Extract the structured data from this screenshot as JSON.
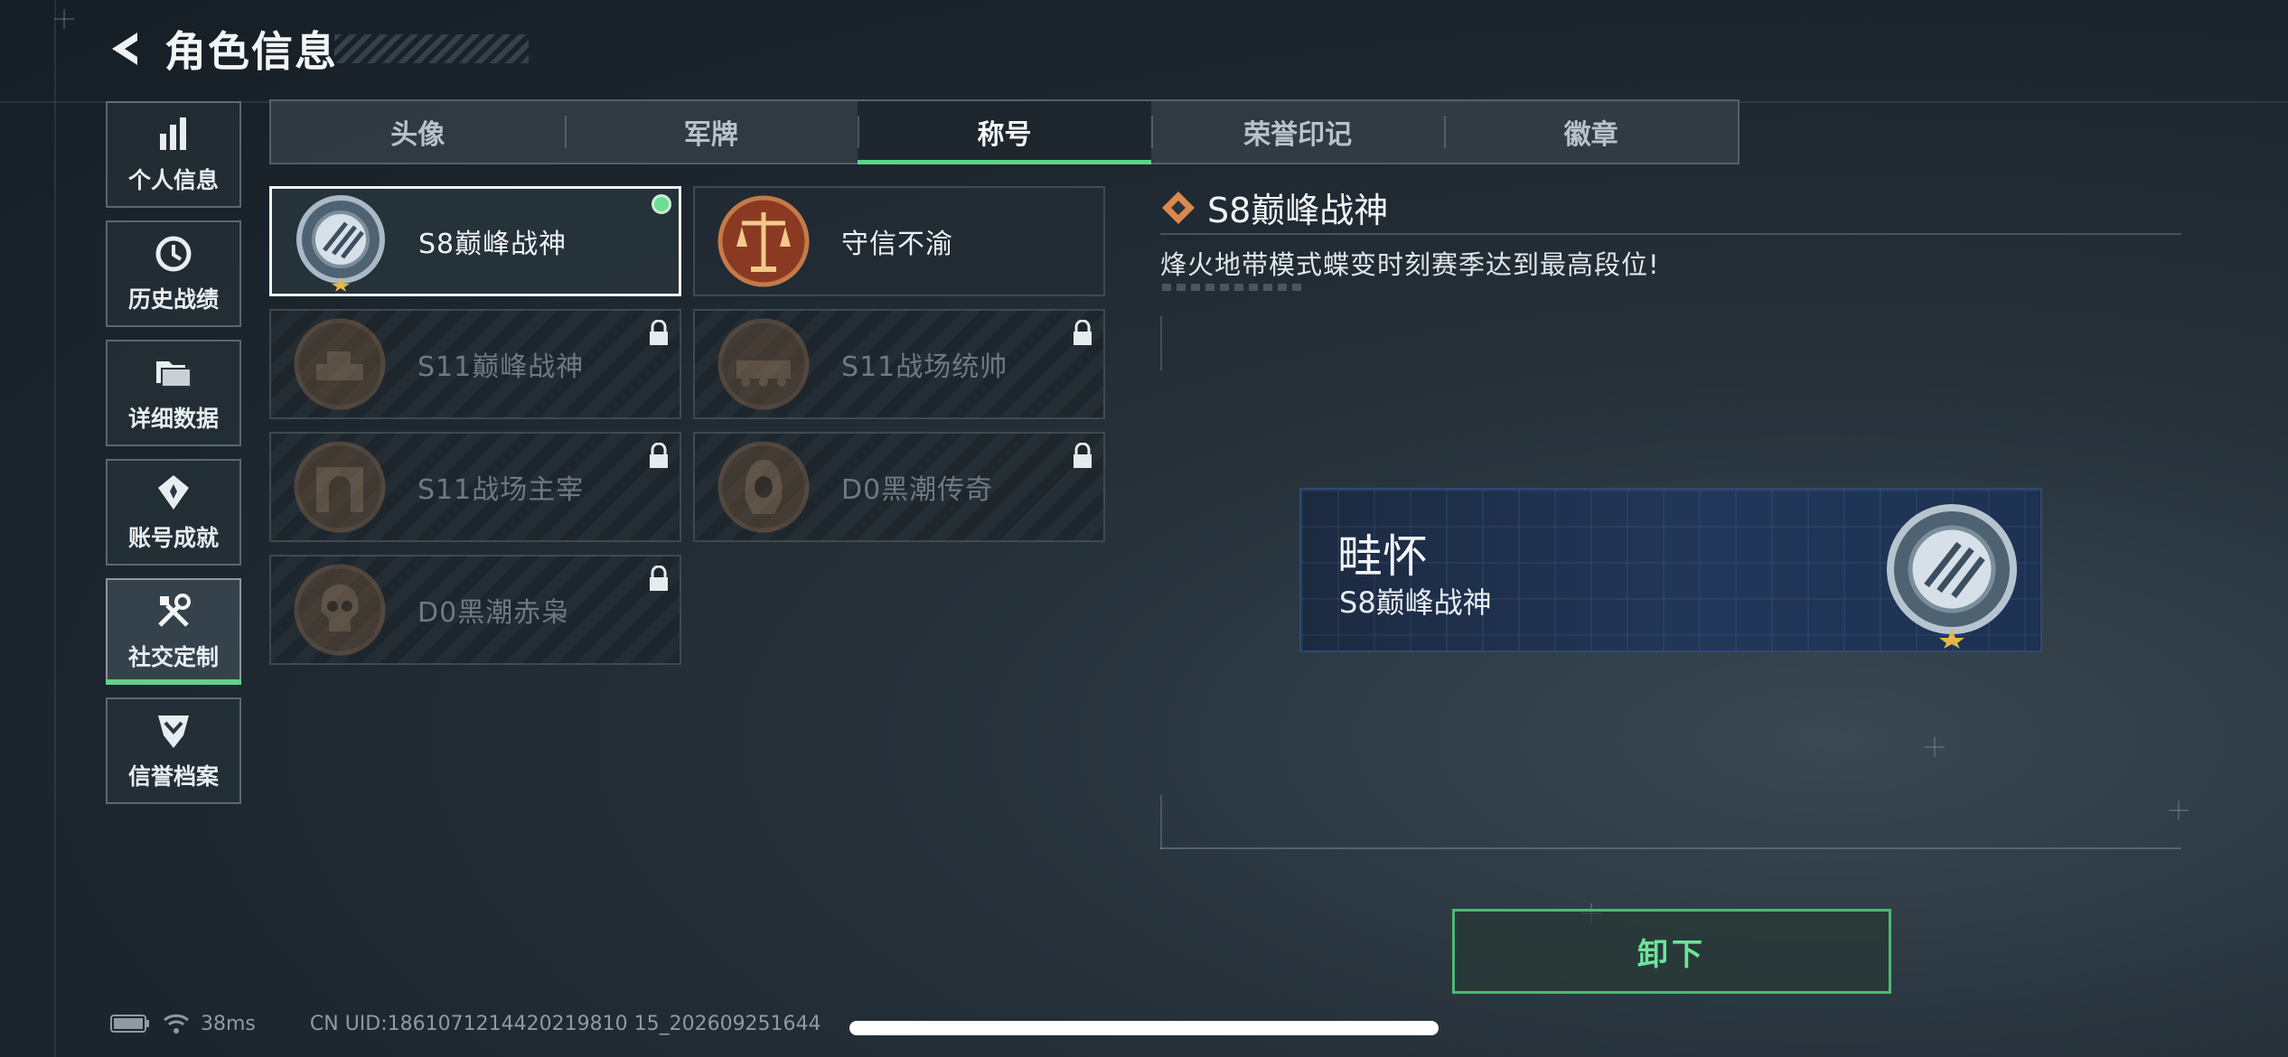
{
  "header": {
    "title": "角色信息"
  },
  "side_nav": [
    {
      "label": "个人信息",
      "icon": "bar-chart-icon",
      "active": false
    },
    {
      "label": "历史战绩",
      "icon": "history-clock-icon",
      "active": false
    },
    {
      "label": "详细数据",
      "icon": "folder-icon",
      "active": false
    },
    {
      "label": "账号成就",
      "icon": "achievement-icon",
      "active": false
    },
    {
      "label": "社交定制",
      "icon": "tools-icon",
      "active": true
    },
    {
      "label": "信誉档案",
      "icon": "shield-chevron-icon",
      "active": false
    }
  ],
  "tabs": [
    {
      "label": "头像",
      "active": false
    },
    {
      "label": "军牌",
      "active": false
    },
    {
      "label": "称号",
      "active": true
    },
    {
      "label": "荣誉印记",
      "active": false
    },
    {
      "label": "徽章",
      "active": false
    }
  ],
  "titles": [
    {
      "name": "S8巅峰战神",
      "locked": false,
      "selected": true,
      "equipped": true
    },
    {
      "name": "守信不渝",
      "locked": false,
      "selected": false,
      "equipped": false
    },
    {
      "name": "S11巅峰战神",
      "locked": true,
      "selected": false,
      "equipped": false
    },
    {
      "name": "S11战场统帅",
      "locked": true,
      "selected": false,
      "equipped": false
    },
    {
      "name": "S11战场主宰",
      "locked": true,
      "selected": false,
      "equipped": false
    },
    {
      "name": "D0黑潮传奇",
      "locked": true,
      "selected": false,
      "equipped": false
    },
    {
      "name": "D0黑潮赤枭",
      "locked": true,
      "selected": false,
      "equipped": false
    }
  ],
  "detail": {
    "title": "S8巅峰战神",
    "description": "烽火地带模式蝶变时刻赛季达到最高段位!"
  },
  "nameplate": {
    "player_name": "畦怀",
    "title": "S8巅峰战神"
  },
  "actions": {
    "unequip_label": "卸下"
  },
  "status_bar": {
    "ping": "38ms",
    "uid": "CN UID:1861071214420219810 15_202609251644"
  },
  "colors": {
    "accent": "#5fd28a",
    "button_text": "#6fe39b"
  }
}
